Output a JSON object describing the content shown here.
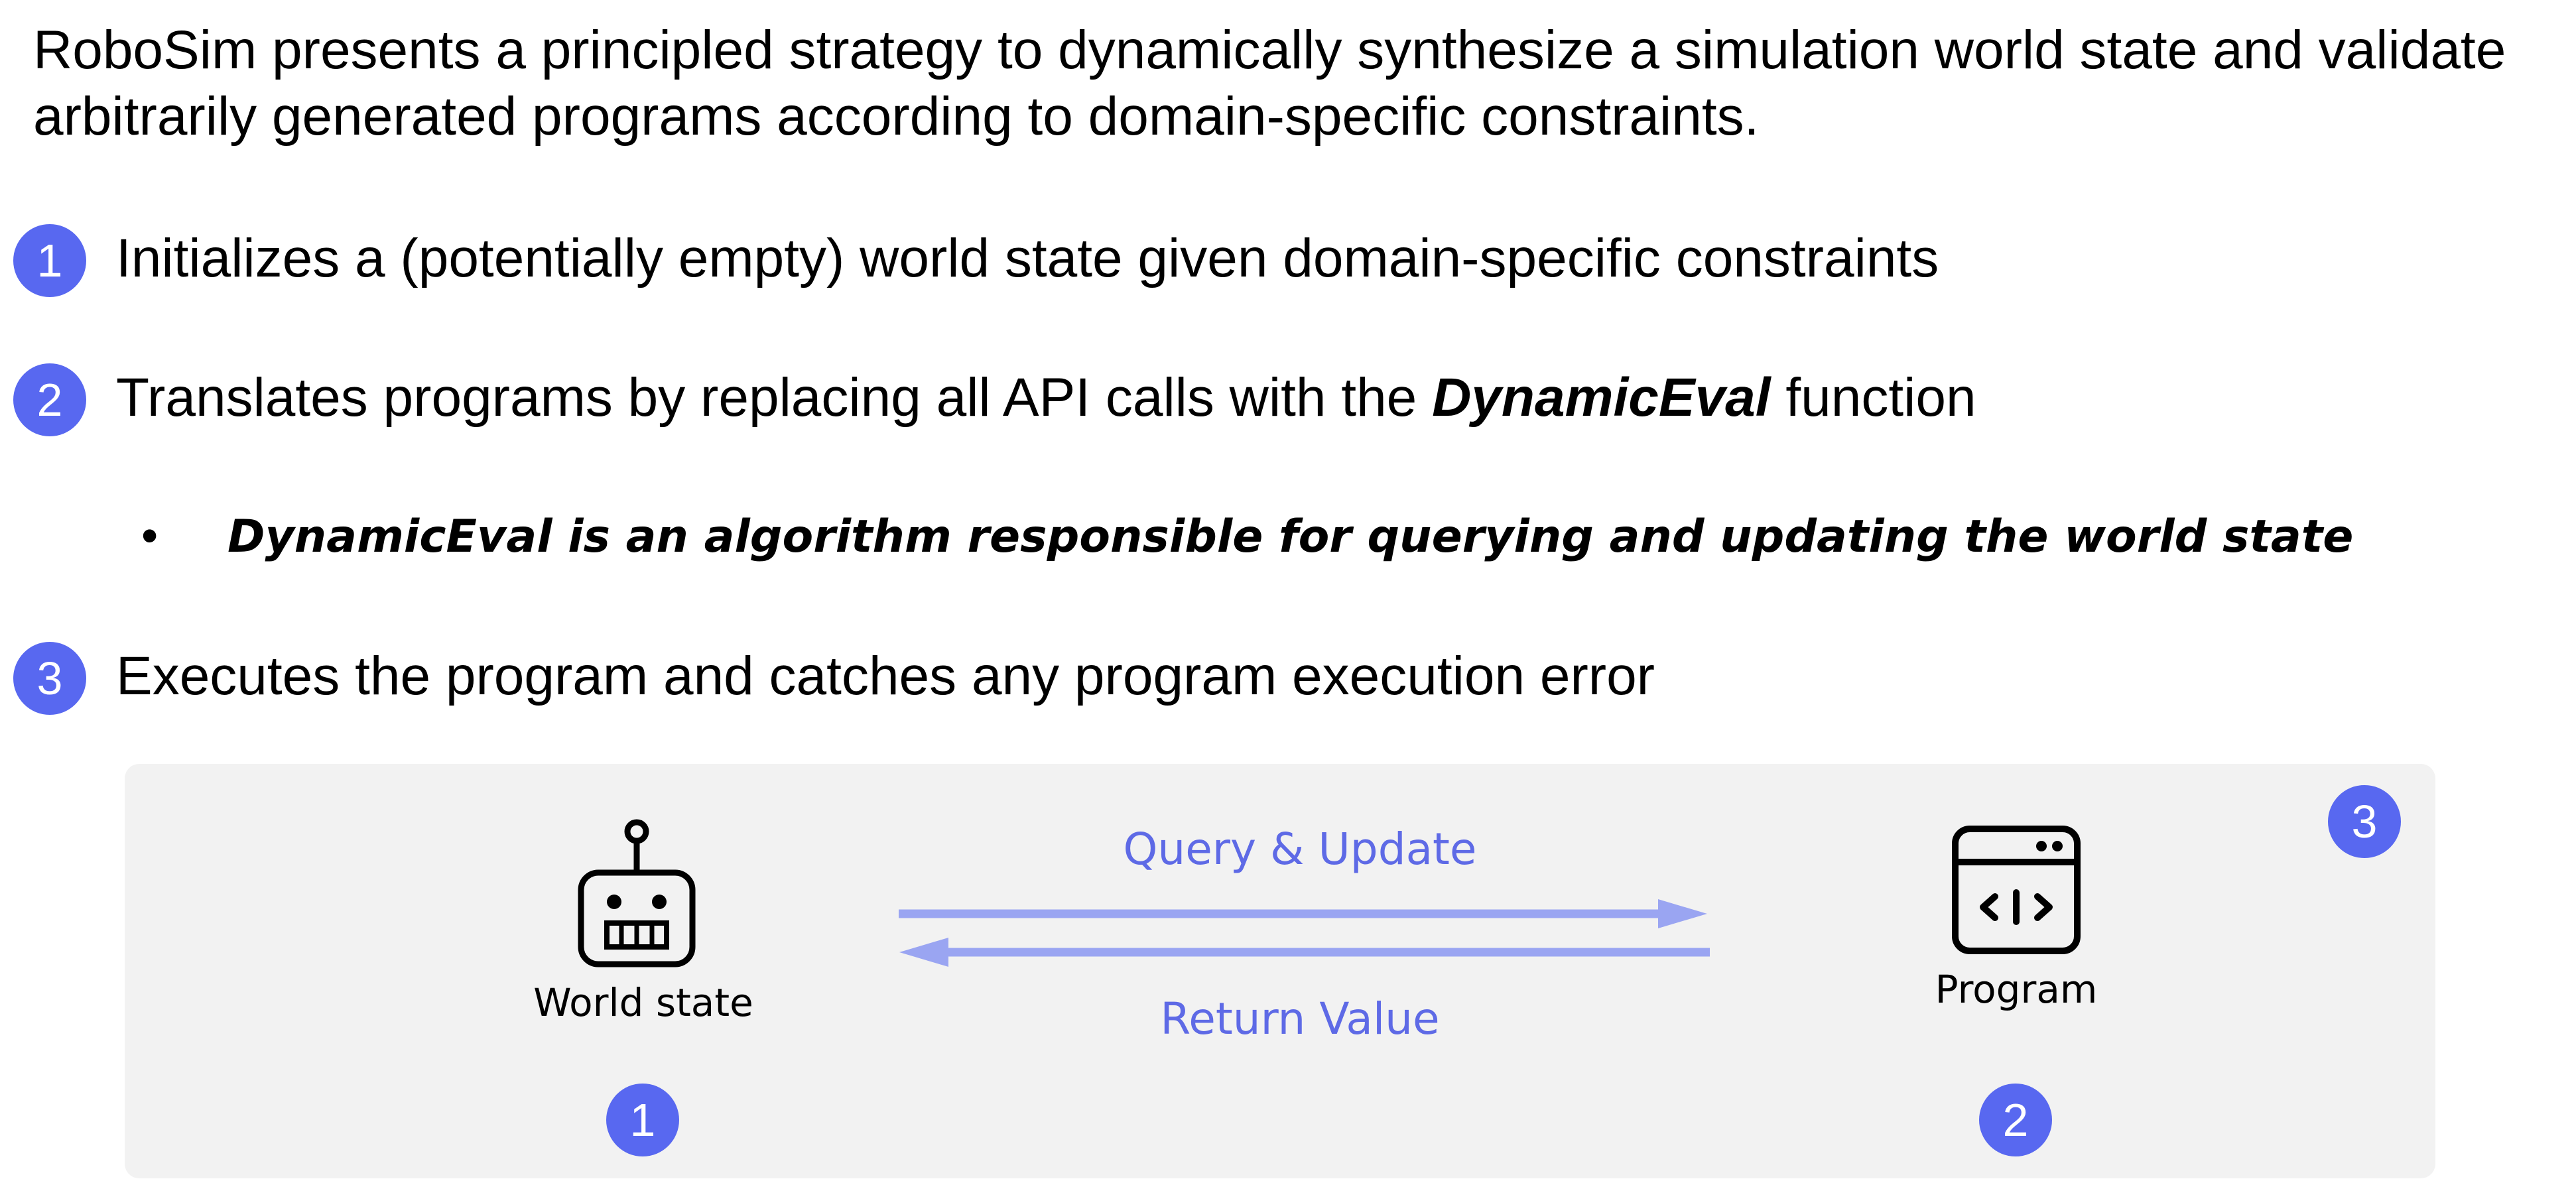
{
  "intro": {
    "line1": "RoboSim presents a principled strategy to dynamically synthesize a simulation world state and validate",
    "line2": "arbitrarily generated programs according to domain-specific constraints."
  },
  "steps": [
    {
      "number": "1",
      "text": "Initializes a (potentially empty) world state given domain-specific constraints"
    },
    {
      "number": "2",
      "text_before": "Translates programs by replacing all API calls with the ",
      "emphasis": "DynamicEval",
      "text_after": " function"
    },
    {
      "number": "3",
      "text": "Executes the program and catches any program execution error"
    }
  ],
  "bullet": {
    "marker": "•",
    "text": "DynamicEval is an algorithm responsible for querying and updating the world state"
  },
  "diagram": {
    "world_state_label": "World state",
    "program_label": "Program",
    "query_label": "Query & Update",
    "return_label": "Return Value",
    "badge_world": "1",
    "badge_program": "2",
    "badge_panel": "3",
    "world_icon": "robot-icon",
    "program_icon": "code-window-icon"
  },
  "colors": {
    "badge": "#5868f0",
    "arrow": "#9aa5f2",
    "arrow_label": "#5e6ae6",
    "panel": "#f2f2f2"
  }
}
